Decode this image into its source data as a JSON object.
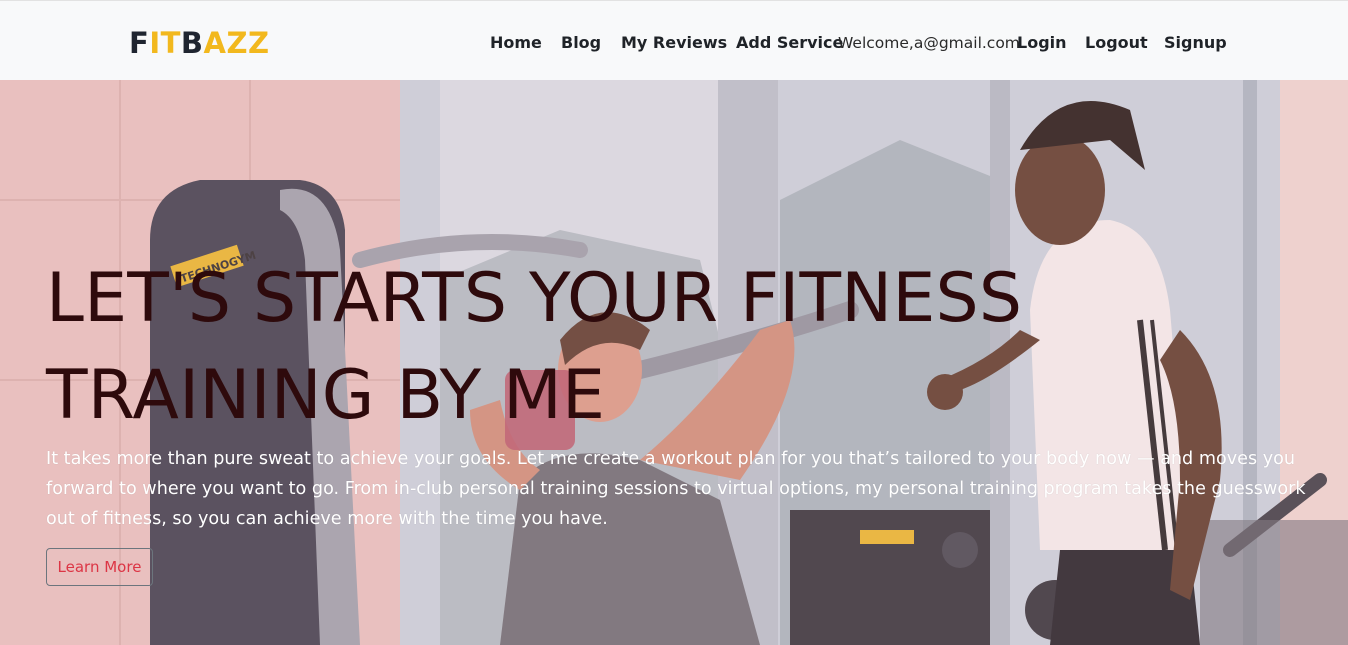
{
  "brand": {
    "letters": [
      "F",
      "IT",
      "B",
      "AZZ"
    ]
  },
  "nav": {
    "home": "Home",
    "blog": "Blog",
    "my_reviews": "My Reviews",
    "add_service": "Add Service",
    "welcome": "Welcome,a@gmail.com",
    "login": "Login",
    "logout": "Logout",
    "signup": "Signup"
  },
  "hero": {
    "headline_line1": "LET'S STARTS YOUR FITNESS",
    "headline_line2": "TRAINING BY ME",
    "description": "It takes more than pure sweat to achieve your goals. Let me create a workout plan for you that’s tailored to your body now — and moves you forward to where you want to go. From in-club personal training sessions to virtual options, my personal training program takes the guesswork out of fitness, so you can achieve more with the time you have.",
    "button_label": "Learn More",
    "machine_brand": "TECHNOGYM"
  },
  "colors": {
    "brand_dark": "#1f2530",
    "brand_gold": "#f2b81d",
    "headline": "#2e0a0c",
    "button_text": "#dc3545",
    "navbar_bg": "#f8f9fa"
  }
}
